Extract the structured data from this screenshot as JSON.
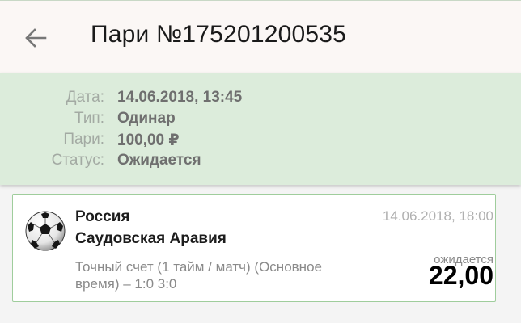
{
  "header": {
    "title": "Пари №175201200535",
    "back_icon": "arrow-left-icon"
  },
  "summary": {
    "rows": [
      {
        "label": "Дата:",
        "value": "14.06.2018, 13:45"
      },
      {
        "label": "Тип:",
        "value": "Одинар"
      },
      {
        "label": "Пари:",
        "value": "100,00 ₽"
      },
      {
        "label": "Статус:",
        "value": "Ожидается"
      }
    ]
  },
  "bet": {
    "sport_icon": "soccer-ball-icon",
    "team_home": "Россия",
    "team_away": "Саудовская Аравия",
    "event_date": "14.06.2018, 18:00",
    "market": "Точный счет (1 тайм / матч) (Основное время) – 1:0 3:0",
    "status": "ожидается",
    "odds": "22,00"
  },
  "colors": {
    "header_bg": "#fbf7f5",
    "summary_bg": "#dcecdb",
    "card_border": "#9fcd9c",
    "label_gray": "#a3aaa3",
    "value_gray": "#6f6f6f"
  }
}
